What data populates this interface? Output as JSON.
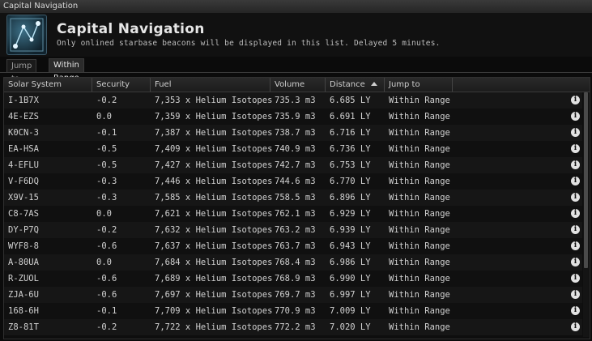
{
  "window": {
    "title": "Capital Navigation"
  },
  "header": {
    "title": "Capital Navigation",
    "subtitle": "Only onlined starbase beacons will be displayed in this list. Delayed 5 minutes."
  },
  "tabs": [
    {
      "label": "Jump to",
      "active": false
    },
    {
      "label": "Within Range",
      "active": true
    }
  ],
  "table": {
    "columns": [
      "Solar System",
      "Security",
      "Fuel",
      "Volume",
      "Distance",
      "Jump to"
    ],
    "sorted_column": "Distance",
    "sort_direction": "ascending",
    "rows": [
      [
        "I-1B7X",
        "-0.2",
        "7,353 x Helium Isotopes",
        "735.3 m3",
        "6.685 LY",
        "Within Range"
      ],
      [
        "4E-EZS",
        "0.0",
        "7,359 x Helium Isotopes",
        "735.9 m3",
        "6.691 LY",
        "Within Range"
      ],
      [
        "K0CN-3",
        "-0.1",
        "7,387 x Helium Isotopes",
        "738.7 m3",
        "6.716 LY",
        "Within Range"
      ],
      [
        "EA-HSA",
        "-0.5",
        "7,409 x Helium Isotopes",
        "740.9 m3",
        "6.736 LY",
        "Within Range"
      ],
      [
        "4-EFLU",
        "-0.5",
        "7,427 x Helium Isotopes",
        "742.7 m3",
        "6.753 LY",
        "Within Range"
      ],
      [
        "V-F6DQ",
        "-0.3",
        "7,446 x Helium Isotopes",
        "744.6 m3",
        "6.770 LY",
        "Within Range"
      ],
      [
        "X9V-15",
        "-0.3",
        "7,585 x Helium Isotopes",
        "758.5 m3",
        "6.896 LY",
        "Within Range"
      ],
      [
        "C8-7AS",
        "0.0",
        "7,621 x Helium Isotopes",
        "762.1 m3",
        "6.929 LY",
        "Within Range"
      ],
      [
        "DY-P7Q",
        "-0.2",
        "7,632 x Helium Isotopes",
        "763.2 m3",
        "6.939 LY",
        "Within Range"
      ],
      [
        "WYF8-8",
        "-0.6",
        "7,637 x Helium Isotopes",
        "763.7 m3",
        "6.943 LY",
        "Within Range"
      ],
      [
        "A-80UA",
        "0.0",
        "7,684 x Helium Isotopes",
        "768.4 m3",
        "6.986 LY",
        "Within Range"
      ],
      [
        "R-ZUOL",
        "-0.6",
        "7,689 x Helium Isotopes",
        "768.9 m3",
        "6.990 LY",
        "Within Range"
      ],
      [
        "ZJA-6U",
        "-0.6",
        "7,697 x Helium Isotopes",
        "769.7 m3",
        "6.997 LY",
        "Within Range"
      ],
      [
        "168-6H",
        "-0.1",
        "7,709 x Helium Isotopes",
        "770.9 m3",
        "7.009 LY",
        "Within Range"
      ],
      [
        "Z8-81T",
        "-0.2",
        "7,722 x Helium Isotopes",
        "772.2 m3",
        "7.020 LY",
        "Within Range"
      ]
    ],
    "row_info_icon": "info-icon",
    "scroll_position_fraction": 0.0
  }
}
